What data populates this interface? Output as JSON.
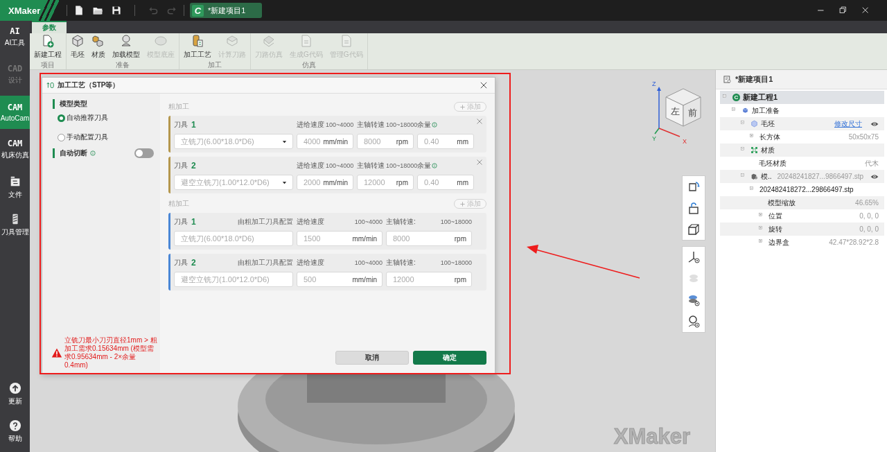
{
  "title_bar": {
    "logo": "XMaker",
    "tools": [
      {
        "kind": "new",
        "disabled": false
      },
      {
        "kind": "open",
        "disabled": false
      },
      {
        "kind": "save",
        "disabled": false
      },
      {
        "kind": "undo",
        "disabled": true
      },
      {
        "kind": "redo",
        "disabled": true
      }
    ],
    "project_tab": {
      "badge": "C",
      "title": "*新建项目1"
    }
  },
  "sidebar": {
    "items": [
      {
        "kind": "ai",
        "glyph": "AI",
        "label": "AI工具",
        "selected": false,
        "disabled": false
      },
      {
        "kind": "cad",
        "glyph": "CAD",
        "label": "设计",
        "selected": false,
        "disabled": true
      },
      {
        "kind": "cam",
        "glyph": "CAM",
        "label": "AutoCam",
        "selected": true,
        "disabled": false
      },
      {
        "kind": "machine",
        "glyph": "CAM",
        "label": "机床仿真",
        "selected": false,
        "disabled": false
      },
      {
        "kind": "file",
        "label": "文件",
        "selected": false,
        "disabled": false
      },
      {
        "kind": "tool",
        "label": "刀具管理",
        "selected": false,
        "disabled": false
      }
    ],
    "bottom": [
      {
        "kind": "update",
        "label": "更新"
      },
      {
        "kind": "help",
        "label": "帮助"
      }
    ]
  },
  "ribbon": {
    "tabs": [
      {
        "label": "参数",
        "selected": true
      }
    ],
    "groups": [
      {
        "label": "项目",
        "buttons": [
          {
            "kind": "new-project",
            "label": "新建工程",
            "disabled": false
          }
        ]
      },
      {
        "label": "准备",
        "buttons": [
          {
            "kind": "stock",
            "label": "毛坯",
            "disabled": false
          },
          {
            "kind": "material",
            "label": "材质",
            "disabled": false
          },
          {
            "kind": "load",
            "label": "加载模型",
            "disabled": false
          },
          {
            "kind": "base",
            "label": "模型底座",
            "disabled": true
          }
        ]
      },
      {
        "label": "加工",
        "buttons": [
          {
            "kind": "process",
            "label": "加工工艺",
            "disabled": false
          },
          {
            "kind": "path",
            "label": "计算刀路",
            "disabled": true
          }
        ]
      },
      {
        "label": "仿真",
        "buttons": [
          {
            "kind": "sim",
            "label": "刀路仿真",
            "disabled": true
          },
          {
            "kind": "gcode",
            "label": "生成G代码",
            "disabled": true
          },
          {
            "kind": "gcode",
            "label": "管理G代码",
            "disabled": true
          }
        ]
      }
    ]
  },
  "viewport": {
    "logo": "XMaker",
    "view_cube": {
      "left": "左",
      "front": "前",
      "axes": [
        "X",
        "Y",
        "Z"
      ]
    },
    "tools": [
      [
        {
          "kind": "rotate",
          "disabled": false
        },
        {
          "kind": "lock",
          "disabled": false
        },
        {
          "kind": "box",
          "disabled": false
        }
      ],
      [
        {
          "kind": "axes",
          "disabled": false
        },
        {
          "kind": "stack",
          "disabled": true
        },
        {
          "kind": "stack-eye",
          "disabled": false
        },
        {
          "kind": "tool-eye",
          "disabled": false
        }
      ]
    ]
  },
  "dialog": {
    "title": "加工工艺（STP等）",
    "left": {
      "type_label": "模型类型",
      "options": [
        {
          "label": "自动推荐刀具",
          "selected": true
        },
        {
          "label": "手动配置刀具",
          "selected": false
        }
      ],
      "auto_cut": {
        "label": "自动切断",
        "on": false
      },
      "error": "立铣刀最小刀刃直径1mm > 粗加工需求0.15634mm (模型需求0.95634mm - 2×余量0.4mm)"
    },
    "sections": [
      {
        "kind": "rough",
        "title": "粗加工",
        "add": "添加",
        "tools": [
          {
            "label": "刀具",
            "num": "1",
            "feed_label": "进给速度",
            "feed_range": "100~4000",
            "spindle_label": "主轴转速",
            "spindle_range": "100~18000",
            "stock_label": "余量",
            "tool": "立铣刀(6.00*18.0*D6)",
            "feed": "4000",
            "feed_unit": "mm/min",
            "spindle": "8000",
            "spindle_unit": "rpm",
            "stock": "0.40",
            "stock_unit": "mm"
          },
          {
            "label": "刀具",
            "num": "2",
            "feed_label": "进给速度",
            "feed_range": "100~4000",
            "spindle_label": "主轴转速",
            "spindle_range": "100~18000",
            "stock_label": "余量",
            "tool": "避空立铣刀(1.00*12.0*D6)",
            "feed": "2000",
            "feed_unit": "mm/min",
            "spindle": "12000",
            "spindle_unit": "rpm",
            "stock": "0.40",
            "stock_unit": "mm"
          }
        ]
      },
      {
        "kind": "finish",
        "title": "精加工",
        "add": "添加",
        "tools": [
          {
            "label": "刀具",
            "num": "1",
            "note": "由粗加工刀具配置",
            "feed_label": "进给速度",
            "feed_range": "100~4000",
            "spindle_label": "主轴转速:",
            "spindle_range": "100~18000",
            "tool": "立铣刀(6.00*18.0*D6)",
            "feed": "1500",
            "feed_unit": "mm/min",
            "spindle": "8000",
            "spindle_unit": "rpm"
          },
          {
            "label": "刀具",
            "num": "2",
            "note": "由粗加工刀具配置",
            "feed_label": "进给速度",
            "feed_range": "100~4000",
            "spindle_label": "主轴转速:",
            "spindle_range": "100~18000",
            "tool": "避空立铣刀(1.00*12.0*D6)",
            "feed": "500",
            "feed_unit": "mm/min",
            "spindle": "12000",
            "spindle_unit": "rpm"
          }
        ]
      }
    ],
    "buttons": [
      {
        "kind": "cancel",
        "label": "取消"
      },
      {
        "kind": "ok",
        "label": "确定"
      }
    ]
  },
  "project_panel": {
    "title": "*新建项目1",
    "tree": [
      {
        "label": "新建工程1",
        "badge": "C",
        "expanded": true,
        "selected": true,
        "children": [
          {
            "label": "加工准备",
            "kind": "cube",
            "expanded": true,
            "selected": false,
            "children": [
              {
                "label": "毛坯",
                "kind": "hex",
                "expanded": true,
                "selected": false,
                "link": "修改尺寸",
                "visible": true,
                "children": [
                  {
                    "label": "长方体",
                    "expanded": false,
                    "selected": false,
                    "value": "50x50x75"
                  }
                ]
              },
              {
                "label": "材质",
                "kind": "material",
                "expanded": true,
                "selected": false,
                "children": [
                  {
                    "label": "毛坯材质",
                    "selected": false,
                    "value": "代木"
                  }
                ]
              },
              {
                "label": "模..",
                "kind": "model",
                "expanded": true,
                "selected": false,
                "value": "20248241827...9866497.stp",
                "visible": true,
                "children": [
                  {
                    "label": "202482418272...29866497.stp",
                    "expanded": true,
                    "selected": false,
                    "children": [
                      {
                        "label": "模型缩放",
                        "selected": false,
                        "value": "46.65%"
                      },
                      {
                        "label": "位置",
                        "expanded": false,
                        "selected": false,
                        "value": "0, 0, 0"
                      },
                      {
                        "label": "旋转",
                        "expanded": false,
                        "selected": false,
                        "value": "0, 0, 0"
                      },
                      {
                        "label": "边界盒",
                        "expanded": false,
                        "selected": false,
                        "value": "42.47*28.92*2.8"
                      }
                    ]
                  }
                ]
              }
            ]
          }
        ]
      }
    ]
  }
}
